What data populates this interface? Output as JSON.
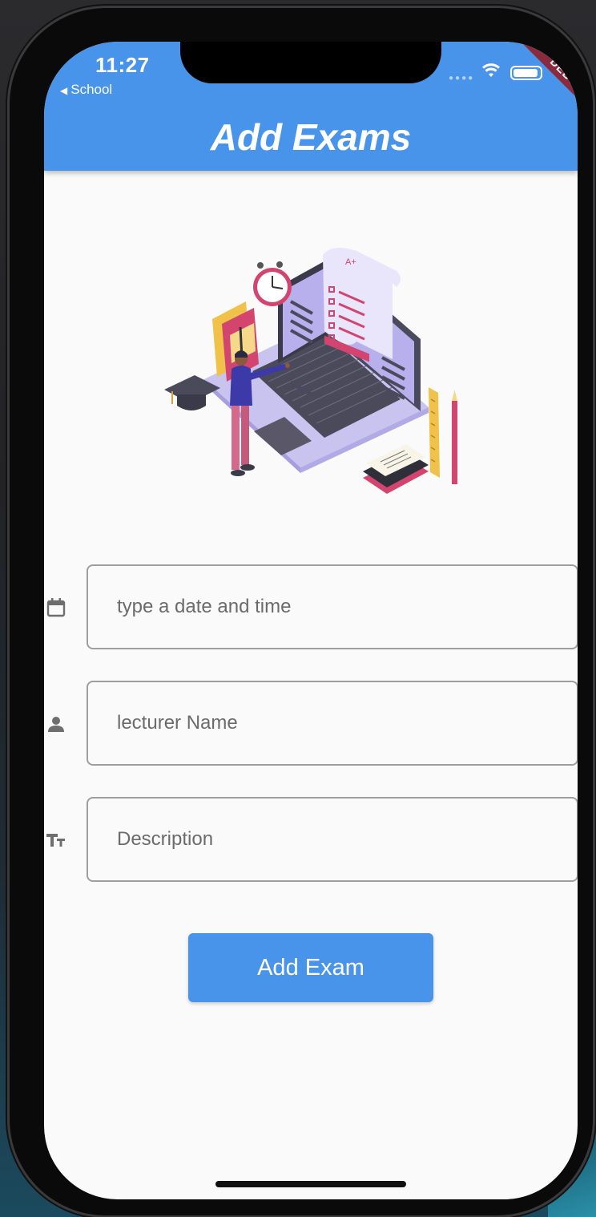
{
  "status_bar": {
    "time": "11:27",
    "back_label": "School",
    "debug_banner": "DEBUG"
  },
  "appbar": {
    "title": "Add Exams",
    "color": "#4894ea"
  },
  "form": {
    "date_field": {
      "placeholder": "type a date and time",
      "icon": "calendar-icon"
    },
    "lecturer_field": {
      "placeholder": "lecturer Name",
      "icon": "person-icon"
    },
    "description_field": {
      "placeholder": "Description",
      "icon": "text-fields-icon"
    },
    "submit_label": "Add Exam"
  },
  "illustration": {
    "name": "exam-laptop-illustration"
  }
}
